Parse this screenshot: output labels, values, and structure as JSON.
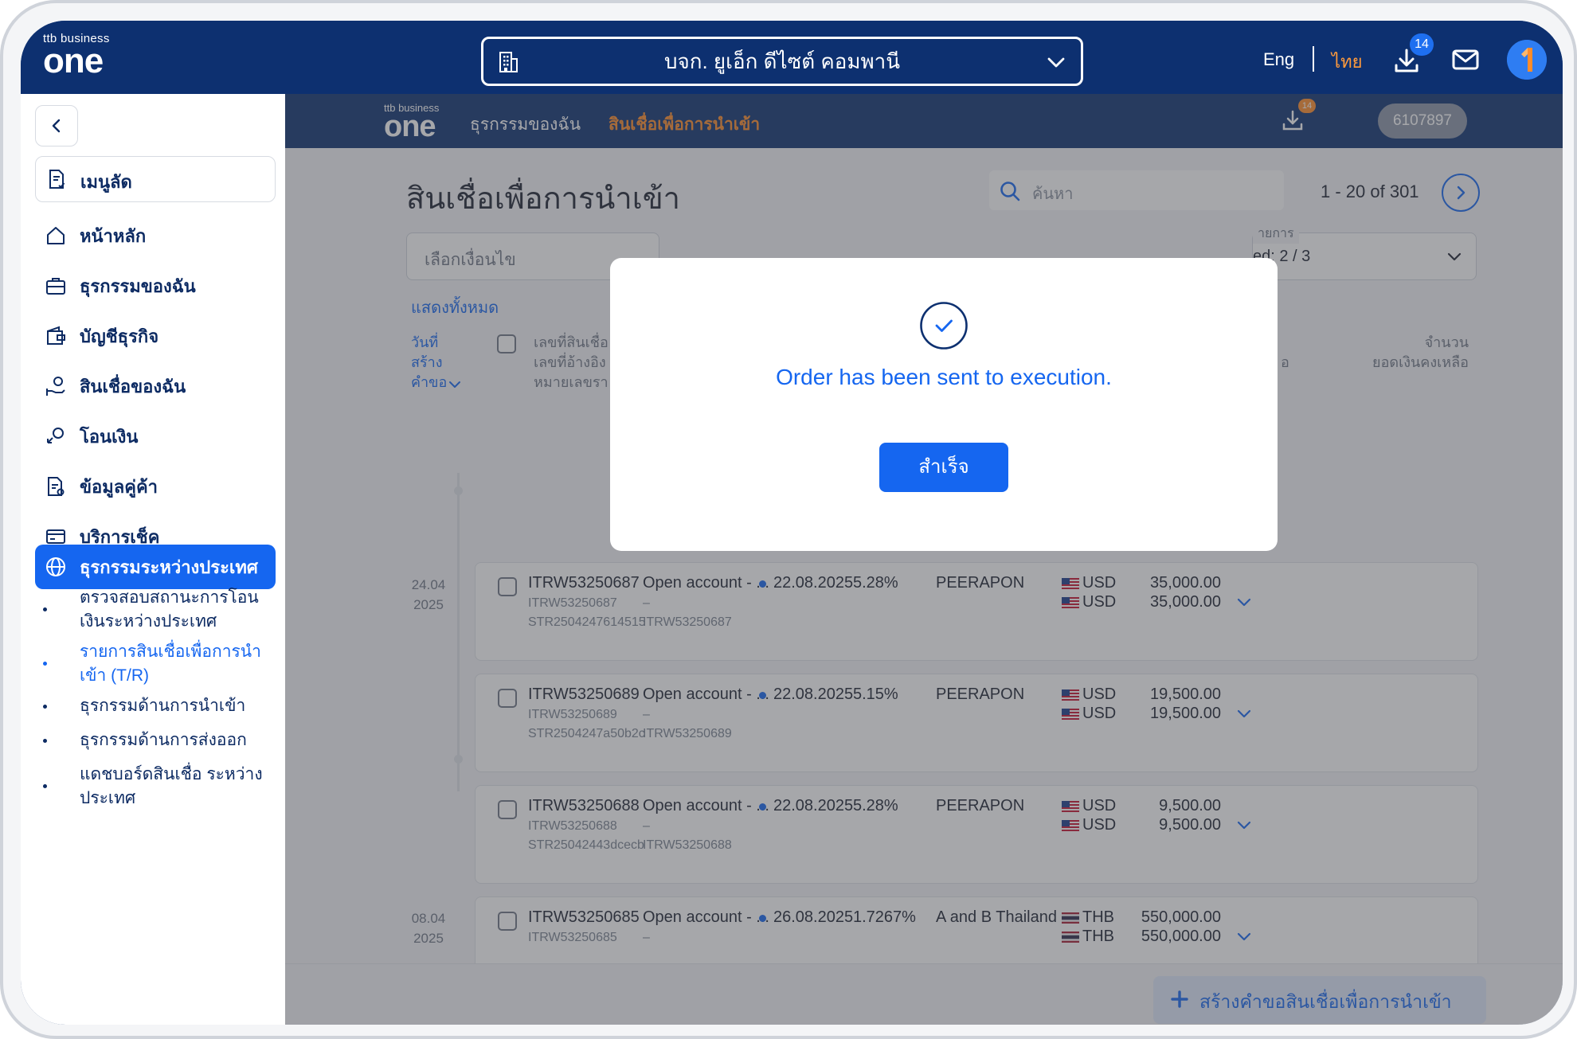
{
  "header": {
    "logo_small": "ttb business",
    "logo_big": "one",
    "company_name": "บจก. ยูเอ็ก ดีไซต์ คอมพานี",
    "lang_eng": "Eng",
    "lang_thai": "ไทย",
    "download_badge": "14"
  },
  "sidebar": {
    "favorites": "เมนูลัด",
    "items": [
      {
        "label": "หน้าหลัก",
        "icon": "home-icon"
      },
      {
        "label": "ธุรกรรมของฉัน",
        "icon": "briefcase-icon"
      },
      {
        "label": "บัญชีธุรกิจ",
        "icon": "wallet-icon"
      },
      {
        "label": "สินเชื่อของฉัน",
        "icon": "loan-hand-icon"
      },
      {
        "label": "โอนเงิน",
        "icon": "transfer-icon"
      },
      {
        "label": "ข้อมูลคู่ค้า",
        "icon": "partner-doc-icon"
      },
      {
        "label": "บริการเช็ค",
        "icon": "cheque-icon"
      },
      {
        "label": "ธุรกรรมระหว่างประเทศ",
        "icon": "globe-icon"
      }
    ],
    "sub_items": [
      "ตรวจสอบสถานะการโอนเงินระหว่างประเทศ",
      "รายการสินเชื่อเพื่อการนำเข้า (T/R)",
      "ธุรกรรมด้านการนำเข้า",
      "ธุรกรรมด้านการส่งออก",
      "แดชบอร์ดสินเชื่อ ระหว่างประเทศ"
    ]
  },
  "inner_nav": {
    "logo_small": "ttb business",
    "logo_big": "one",
    "link_1": "ธุรกรรมของฉัน",
    "link_2": "สินเชื่อเพื่อการนำเข้า",
    "download_badge": "14",
    "account": "6107897"
  },
  "page": {
    "title": "สินเชื่อเพื่อการนำเข้า",
    "search_placeholder": "ค้นหา",
    "pager": "1 - 20 of 301",
    "filter_placeholder": "เลือกเงื่อนไข",
    "filter2_label": "ายการ",
    "filter2_value": "ed: 2 / 3",
    "show_all": "แสดงทั้งหมด",
    "col_date": [
      "วันที่",
      "สร้าง",
      "คำขอ"
    ],
    "col_ref": [
      "เลขที่สินเชื่อ",
      "เลขที่อ้างอิง",
      "หมายเลขรา"
    ],
    "col_amount": "จำนวน",
    "col_balance": "ยอดเงินคงเหลือ",
    "col_mid_fragment": "อ",
    "create_button": "สร้างคำขอสินเชื่อเพื่อการนำเข้า"
  },
  "timeline": [
    {
      "date": "24.04",
      "year": "2025"
    },
    {
      "date": "08.04",
      "year": "2025"
    }
  ],
  "rows": [
    {
      "loan_no": "ITRW53250687",
      "ref": "ITRW53250687",
      "str": "STR2504247614515",
      "type": "Open account - ...",
      "type_sub": "–",
      "type_ref": "ITRW53250687",
      "due": "22.08.2025",
      "rate": "5.28%",
      "party": "PEERAPON",
      "ccy1": "USD",
      "ccy2": "USD",
      "amount": "35,000.00",
      "balance": "35,000.00",
      "flag": "us"
    },
    {
      "loan_no": "ITRW53250689",
      "ref": "ITRW53250689",
      "str": "STR2504247a50b2c",
      "type": "Open account - ...",
      "type_sub": "–",
      "type_ref": "ITRW53250689",
      "due": "22.08.2025",
      "rate": "5.15%",
      "party": "PEERAPON",
      "ccy1": "USD",
      "ccy2": "USD",
      "amount": "19,500.00",
      "balance": "19,500.00",
      "flag": "us"
    },
    {
      "loan_no": "ITRW53250688",
      "ref": "ITRW53250688",
      "str": "STR25042443dcecb",
      "type": "Open account - ...",
      "type_sub": "–",
      "type_ref": "ITRW53250688",
      "due": "22.08.2025",
      "rate": "5.28%",
      "party": "PEERAPON",
      "ccy1": "USD",
      "ccy2": "USD",
      "amount": "9,500.00",
      "balance": "9,500.00",
      "flag": "us"
    },
    {
      "loan_no": "ITRW53250685",
      "ref": "ITRW53250685",
      "str": "",
      "type": "Open account - ...",
      "type_sub": "–",
      "type_ref": "",
      "due": "26.08.2025",
      "rate": "1.7267%",
      "party": "A and B Thailand",
      "ccy1": "THB",
      "ccy2": "THB",
      "amount": "550,000.00",
      "balance": "550,000.00",
      "flag": "th"
    }
  ],
  "modal": {
    "message": "Order has been sent to execution.",
    "button": "สำเร็จ"
  },
  "colors": {
    "navy": "#0d3070",
    "primary_blue": "#1566f0",
    "accent_orange": "#ff8c2a"
  }
}
